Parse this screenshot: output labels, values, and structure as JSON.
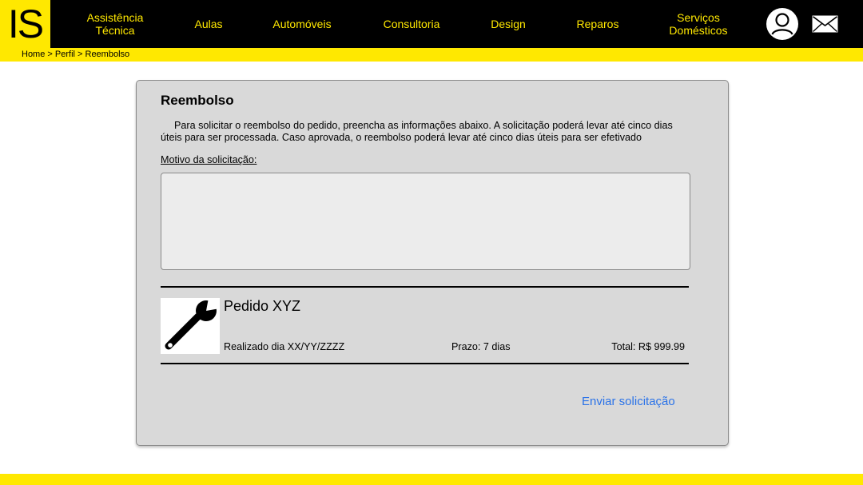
{
  "brand": {
    "logo_text": "IS"
  },
  "nav": {
    "assistencia_l1": "Assistência",
    "assistencia_l2": "Técnica",
    "aulas": "Aulas",
    "automoveis": "Automóveis",
    "consultoria": "Consultoria",
    "design": "Design",
    "reparos": "Reparos",
    "servicos_l1": "Serviços",
    "servicos_l2": "Domésticos"
  },
  "icons": {
    "avatar": "user-circle-icon",
    "mail": "envelope-icon",
    "order": "wrench-icon"
  },
  "breadcrumb": {
    "home": "Home",
    "sep1": " > ",
    "perfil": "Perfil",
    "sep2": " > ",
    "current": "Reembolso"
  },
  "form": {
    "title": "Reembolso",
    "intro": "Para solicitar o reembolso do pedido, preencha as informações abaixo. A solicitação poderá levar até cinco dias úteis para ser processada. Caso aprovada, o reembolso poderá levar até cinco dias úteis para ser efetivado",
    "motivo_label": "Motivo da solicitação:",
    "motivo_value": "",
    "submit_label": "Enviar solicitação"
  },
  "order": {
    "name": "Pedido XYZ",
    "date": "Realizado dia XX/YY/ZZZZ",
    "prazo": "Prazo: 7 dias",
    "total": "Total: R$ 999.99"
  },
  "colors": {
    "accent": "#ffe800",
    "header_bg": "#000000",
    "card_bg": "#d9d9d9",
    "link": "#2b73e8"
  }
}
